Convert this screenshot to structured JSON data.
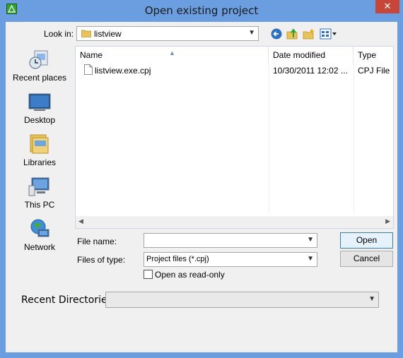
{
  "window": {
    "title": "Open existing project",
    "close_glyph": "✕"
  },
  "toolbar": {
    "lookin_label": "Look in:",
    "lookin_value": "listview",
    "icons": [
      "back-icon",
      "up-folder-icon",
      "new-folder-icon",
      "view-menu-icon"
    ]
  },
  "places": [
    {
      "label": "Recent places",
      "icon": "recent-places-icon"
    },
    {
      "label": "Desktop",
      "icon": "desktop-icon"
    },
    {
      "label": "Libraries",
      "icon": "libraries-icon"
    },
    {
      "label": "This PC",
      "icon": "this-pc-icon"
    },
    {
      "label": "Network",
      "icon": "network-icon"
    }
  ],
  "list": {
    "columns": [
      "Name",
      "Date modified",
      "Type"
    ],
    "rows": [
      {
        "name": "listview.exe.cpj",
        "date": "10/30/2011 12:02 ...",
        "type": "CPJ File"
      }
    ]
  },
  "form": {
    "filename_label": "File name:",
    "filename_value": "",
    "filetype_label": "Files of type:",
    "filetype_value": "Project files (*.cpj)",
    "readonly_label": "Open as read-only",
    "readonly_checked": false,
    "open_label": "Open",
    "cancel_label": "Cancel"
  },
  "recent": {
    "label": "Recent Directories:",
    "value": ""
  },
  "colors": {
    "titlebar": "#6b9ee0",
    "close": "#c7463a",
    "client": "#f0f0f0"
  }
}
